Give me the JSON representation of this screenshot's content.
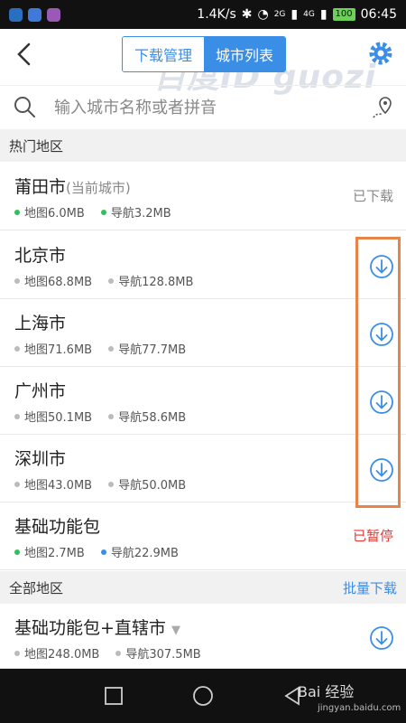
{
  "status_bar": {
    "speed": "1.4K/s",
    "network_2g": "2G",
    "network_4g": "4G",
    "battery": "100",
    "time": "06:45"
  },
  "header": {
    "tabs": [
      {
        "label": "下载管理",
        "active": false
      },
      {
        "label": "城市列表",
        "active": true
      }
    ],
    "watermark": "百度ID guozi"
  },
  "search": {
    "placeholder": "输入城市名称或者拼音"
  },
  "hot_section": {
    "title": "热门地区"
  },
  "hot_rows": [
    {
      "name": "莆田市",
      "sub": "(当前城市)",
      "map": "地图6.0MB",
      "nav": "导航3.2MB",
      "status": "已下载",
      "dot": "green"
    },
    {
      "name": "北京市",
      "sub": "",
      "map": "地图68.8MB",
      "nav": "导航128.8MB",
      "status": "download",
      "dot": "grey"
    },
    {
      "name": "上海市",
      "sub": "",
      "map": "地图71.6MB",
      "nav": "导航77.7MB",
      "status": "download",
      "dot": "grey"
    },
    {
      "name": "广州市",
      "sub": "",
      "map": "地图50.1MB",
      "nav": "导航58.6MB",
      "status": "download",
      "dot": "grey"
    },
    {
      "name": "深圳市",
      "sub": "",
      "map": "地图43.0MB",
      "nav": "导航50.0MB",
      "status": "download",
      "dot": "grey"
    },
    {
      "name": "基础功能包",
      "sub": "",
      "map": "地图2.7MB",
      "nav": "导航22.9MB",
      "status": "已暂停",
      "dot": "green"
    }
  ],
  "all_section": {
    "title": "全部地区",
    "action": "批量下载"
  },
  "all_rows": [
    {
      "name": "基础功能包+直辖市",
      "map": "地图248.0MB",
      "nav": "导航307.5MB"
    }
  ],
  "footer": {
    "brand": "Bai 经验",
    "url": "jingyan.baidu.com"
  },
  "colors": {
    "accent": "#3a8ee6",
    "paused": "#e53935",
    "highlight": "#e8844a"
  }
}
